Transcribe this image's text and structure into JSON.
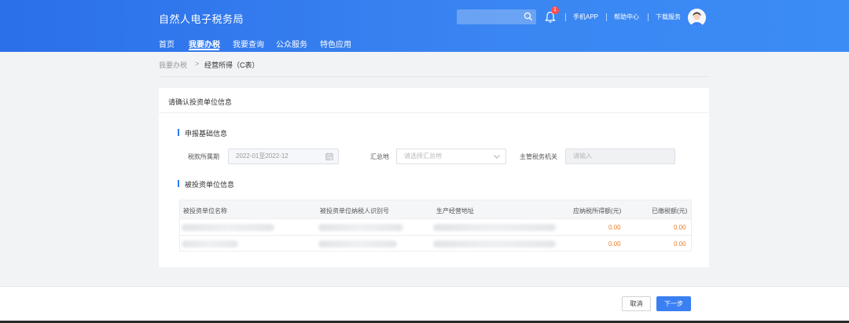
{
  "header": {
    "app_title": "自然人电子税务局",
    "notification_count": "1",
    "links": [
      "手机APP",
      "帮助中心",
      "下载服务"
    ],
    "nav": [
      "首页",
      "我要办税",
      "我要查询",
      "公众服务",
      "特色应用"
    ],
    "active_nav": "我要办税"
  },
  "breadcrumb": {
    "parent": "我要办税",
    "separator": ">",
    "current": "经营所得（C表）"
  },
  "card": {
    "title": "请确认投资单位信息",
    "basic_section": {
      "title": "申报基础信息",
      "period_label": "税款所属期",
      "period_value": "2022-01至2022-12",
      "location_label": "汇总地",
      "location_placeholder": "请选择汇总地",
      "authority_label": "主管税务机关",
      "authority_placeholder": "请输入"
    },
    "invest_section": {
      "title": "被投资单位信息",
      "columns": [
        "被投资单位名称",
        "被投资单位纳税人识别号",
        "生产经营地址",
        "应纳税所得额(元)",
        "已缴税额(元)"
      ],
      "rows": [
        {
          "taxable_income": "0.00",
          "tax_paid": "0.00"
        },
        {
          "taxable_income": "0.00",
          "tax_paid": "0.00"
        }
      ]
    }
  },
  "footer": {
    "cancel_label": "取消",
    "next_label": "下一步"
  },
  "colors": {
    "brand_blue": "#2f7bf0",
    "amount_orange": "#f07b25"
  },
  "icons": [
    "search-icon",
    "bell-icon",
    "user-avatar",
    "calendar-icon",
    "chevron-down-icon"
  ]
}
